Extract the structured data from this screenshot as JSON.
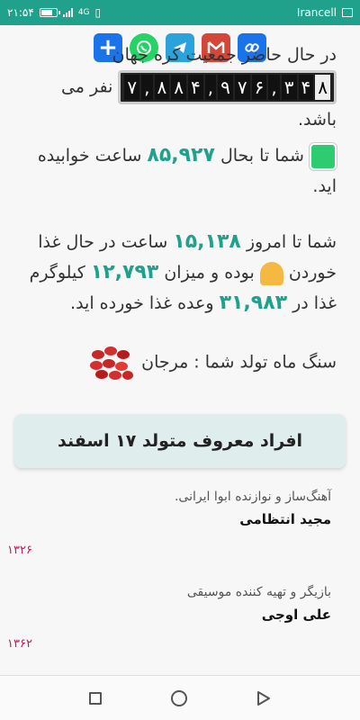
{
  "status_bar": {
    "time": "۲۱:۵۴",
    "carrier": "Irancell",
    "network": "4G"
  },
  "share_bar": {
    "icons": [
      "plus-icon",
      "whatsapp-icon",
      "telegram-icon",
      "gmail-icon",
      "link-icon"
    ],
    "colors": [
      "#1a73e8",
      "#25d366",
      "#2aa3dd",
      "#d44638",
      "#1a73e8"
    ]
  },
  "population": {
    "part1": "در حال حاضر جمعیت کره جهان",
    "digits": [
      "۷",
      ",",
      "۸",
      "۸",
      "۴",
      ",",
      "۹",
      "۷",
      "۶",
      ",",
      "۳",
      "۴",
      "۸"
    ],
    "part2": "نفر می باشد."
  },
  "sleep": {
    "prefix": "شما تا بحال",
    "value": "۸۵,۹۲۷",
    "suffix": "ساعت خوابیده اید."
  },
  "food": {
    "p1": "شما تا امروز",
    "hours": "۱۵,۱۳۸",
    "p2": "ساعت در حال غذا خوردن",
    "p3": "بوده و میزان",
    "kg": "۱۲,۷۹۳",
    "p4": "کیلوگرم غذا در",
    "meals": "۳۱,۹۸۳",
    "p5": "وعده غذا خورده اید."
  },
  "birthstone": {
    "text": "سنگ ماه تولد شما : مرجان"
  },
  "famous": {
    "title": "افراد معروف متولد ۱۷ اسفند",
    "people": [
      {
        "job": "آهنگ‌ساز و نوازنده ابوا ایرانی.",
        "name": "مجید انتظامی",
        "year": "۱۳۲۶"
      },
      {
        "job": "بازیگر و تهیه کننده موسیقی",
        "name": "علی اوجی",
        "year": "۱۳۶۲"
      }
    ]
  }
}
